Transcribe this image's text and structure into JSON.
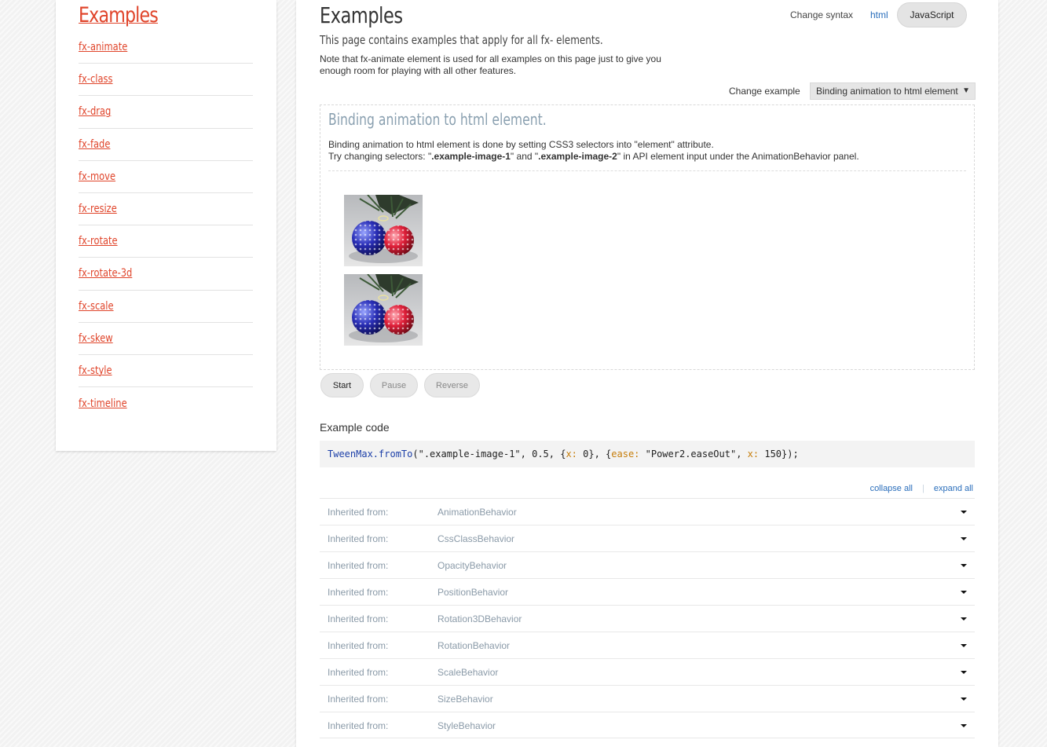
{
  "sidebar": {
    "title": "Examples",
    "items": [
      {
        "label": "fx-animate"
      },
      {
        "label": "fx-class"
      },
      {
        "label": "fx-drag"
      },
      {
        "label": "fx-fade"
      },
      {
        "label": "fx-move"
      },
      {
        "label": "fx-resize"
      },
      {
        "label": "fx-rotate"
      },
      {
        "label": "fx-rotate-3d"
      },
      {
        "label": "fx-scale"
      },
      {
        "label": "fx-skew"
      },
      {
        "label": "fx-style"
      },
      {
        "label": "fx-timeline"
      }
    ]
  },
  "main": {
    "title": "Examples",
    "subtitle": "This page contains examples that apply for all fx- elements.",
    "note": "Note that fx-animate element is used for all examples on this page just to give you enough room for playing with all other features.",
    "syntax": {
      "label": "Change syntax",
      "html": "html",
      "javascript": "JavaScript"
    },
    "change_example": {
      "label": "Change example",
      "selected": "Binding animation to html element",
      "arrow": "▼"
    },
    "demo": {
      "title": "Binding animation to html element.",
      "line1": "Binding animation to html element is done by setting CSS3 selectors into \"element\" attribute.",
      "line2_prefix": "Try changing selectors: \"",
      "selector1": ".example-image-1",
      "line2_mid": "\" and \"",
      "selector2": ".example-image-2",
      "line2_suffix": "\" in API element input under the AnimationBehavior panel."
    },
    "buttons": {
      "start": "Start",
      "pause": "Pause",
      "reverse": "Reverse"
    },
    "code": {
      "heading": "Example code",
      "fn": "TweenMax.fromTo",
      "p1": "(\".example-image-1\", 0.5, {",
      "k1": "x:",
      "p2": " 0}, {",
      "k2": "ease:",
      "p3": " \"Power2.easeOut\", ",
      "k3": "x:",
      "p4": " 150});"
    },
    "collapse_all": "collapse all",
    "separator": "|",
    "expand_all": "expand all",
    "inherited": [
      {
        "label": "Inherited from:",
        "name": "AnimationBehavior"
      },
      {
        "label": "Inherited from:",
        "name": "CssClassBehavior"
      },
      {
        "label": "Inherited from:",
        "name": "OpacityBehavior"
      },
      {
        "label": "Inherited from:",
        "name": "PositionBehavior"
      },
      {
        "label": "Inherited from:",
        "name": "Rotation3DBehavior"
      },
      {
        "label": "Inherited from:",
        "name": "RotationBehavior"
      },
      {
        "label": "Inherited from:",
        "name": "ScaleBehavior"
      },
      {
        "label": "Inherited from:",
        "name": "SizeBehavior"
      },
      {
        "label": "Inherited from:",
        "name": "StyleBehavior"
      }
    ]
  }
}
